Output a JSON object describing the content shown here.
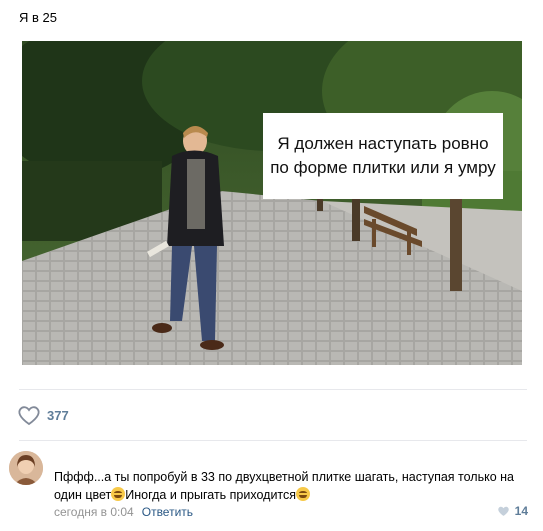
{
  "post": {
    "text": "Я в 25",
    "image_caption_line1": "Я должен наступать ровно",
    "image_caption_line2": "по форме плитки или я умру",
    "likes_count": "377"
  },
  "comment": {
    "text_part1": "Пффф...а ты попробуй в 33 по двухцветной плитке шагать, наступая только на один цвет",
    "text_part2": "Иногда и прыгать приходится",
    "timestamp": "сегодня в 0:04",
    "reply_label": "Ответить",
    "likes_count": "14"
  },
  "colors": {
    "accent_link": "#2a5885",
    "like_count": "#5f7d99",
    "meta_text": "#939393",
    "divider": "#e7e8ec"
  },
  "icons": {
    "like": "heart-outline-icon",
    "comment_like": "heart-small-icon",
    "emoji": "laughing-emoji-icon"
  }
}
